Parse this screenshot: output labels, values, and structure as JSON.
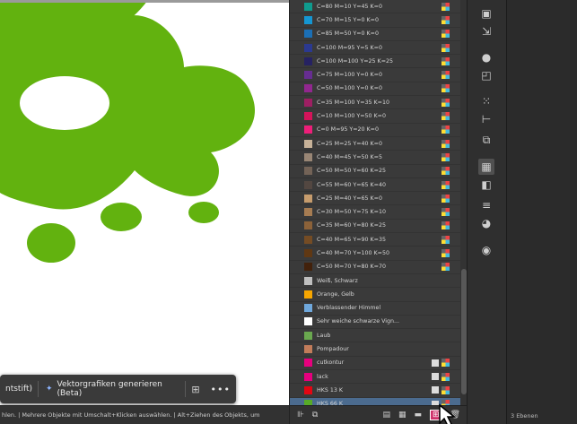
{
  "taskbar": {
    "fragment": "ntstift)",
    "generate_label": "Vektorgrafiken generieren (Beta)",
    "more_label": "•••"
  },
  "statusbar": {
    "text": "hlen.  |  Mehrere Objekte mit Umschalt+Klicken auswählen.  |  Alt+Ziehen des Objekts, um",
    "field": "Ansicht"
  },
  "swatches": [
    {
      "label": "C=80 M=10 Y=45 K=0",
      "color": "#0f9b8e"
    },
    {
      "label": "C=70 M=15 Y=0 K=0",
      "color": "#1596d2"
    },
    {
      "label": "C=85 M=50 Y=0 K=0",
      "color": "#1b6fb5"
    },
    {
      "label": "C=100 M=95 Y=5 K=0",
      "color": "#2b3990"
    },
    {
      "label": "C=100 M=100 Y=25 K=25",
      "color": "#262262"
    },
    {
      "label": "C=75 M=100 Y=0 K=0",
      "color": "#662d91"
    },
    {
      "label": "C=50 M=100 Y=0 K=0",
      "color": "#92278f"
    },
    {
      "label": "C=35 M=100 Y=35 K=10",
      "color": "#9e1f63"
    },
    {
      "label": "C=10 M=100 Y=50 K=0",
      "color": "#d4145a"
    },
    {
      "label": "C=0 M=95 Y=20 K=0",
      "color": "#ed1e79"
    },
    {
      "label": "C=25 M=25 Y=40 K=0",
      "color": "#c7b299"
    },
    {
      "label": "C=40 M=45 Y=50 K=5",
      "color": "#998675"
    },
    {
      "label": "C=50 M=50 Y=60 K=25",
      "color": "#736357"
    },
    {
      "label": "C=55 M=60 Y=65 K=40",
      "color": "#534741"
    },
    {
      "label": "C=25 M=40 Y=65 K=0",
      "color": "#c69c6d"
    },
    {
      "label": "C=30 M=50 Y=75 K=10",
      "color": "#a67c52"
    },
    {
      "label": "C=35 M=60 Y=80 K=25",
      "color": "#8c6239"
    },
    {
      "label": "C=40 M=65 Y=90 K=35",
      "color": "#754c24"
    },
    {
      "label": "C=40 M=70 Y=100 K=50",
      "color": "#603813"
    },
    {
      "label": "C=50 M=70 Y=80 K=70",
      "color": "#42210b"
    }
  ],
  "gradients": [
    {
      "label": "Weiß, Schwarz",
      "color": "#bfbfbf"
    },
    {
      "label": "Orange, Gelb",
      "color": "#f7a600"
    },
    {
      "label": "Verblassender Himmel",
      "color": "#6fa8dc"
    },
    {
      "label": "Sehr weiche schwarze Vign...",
      "color": "#ffffff"
    },
    {
      "label": "Laub",
      "color": "#6aa84f"
    },
    {
      "label": "Pompadour",
      "color": "#c27c5a"
    }
  ],
  "spots": [
    {
      "label": "cutkontur",
      "color": "#e6007e"
    },
    {
      "label": "lack",
      "color": "#e6007e"
    },
    {
      "label": "HKS 13 K",
      "color": "#e30613"
    },
    {
      "label": "HKS 66 K",
      "color": "#57ab27"
    }
  ],
  "fr_status": "3 Ebenen",
  "colors": {
    "blob": "#62b20f",
    "selected": "#4b6b8f"
  }
}
